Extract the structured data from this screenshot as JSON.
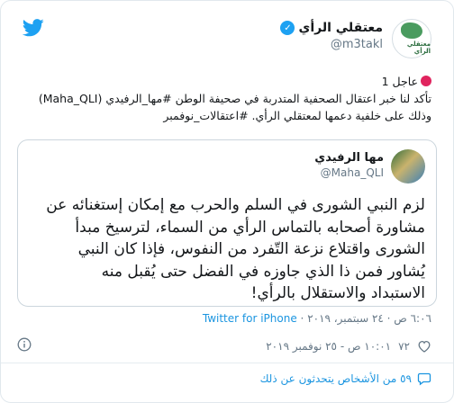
{
  "account": {
    "display_name": "معتقلي الرأي",
    "handle": "@m3takl",
    "avatar_text": "معتقلي الرأي"
  },
  "tweet": {
    "lines": [
      "عاجل 1",
      "تأكد لنا خبر اعتقال الصحفية المتدربة في صحيفة الوطن #مها_الرفيدي (Maha_QLI)",
      "وذلك على خلفية دعمها لمعتقلي الرأي. #اعتقالات_نوفمبر"
    ]
  },
  "quote": {
    "display_name": "مها الرفيدي",
    "handle": "@Maha_QLI",
    "lines": [
      "لزم النبي الشورى في السلم والحرب مع إمكان إستغنائه عن",
      "مشاورة أصحابه بالتماس الرأي من السماء، لترسيخ مبدأ",
      "الشورى واقتلاع نزعة التّفرد من النفوس، فإذا كان النبي",
      "يُشاور فمن ذا الذي جاوزه في الفضل حتى يُقبل منه",
      "الاستبداد والاستقلال بالرأي!"
    ],
    "meta_time": "٦:٠٦ ص · ٢٤ سبتمبر، ٢٠١٩ ·",
    "meta_source": "Twitter for iPhone"
  },
  "stats": {
    "likes": "٧٢",
    "timestamp": "١٠:٠١ ص - ٢٥ نوفمبر ٢٠١٩"
  },
  "footer": {
    "text": "٥٩ من الأشخاص يتحدثون عن ذلك"
  },
  "colors": {
    "link": "#1b95e0",
    "verified": "#1da1f2",
    "urgent_dot": "#e0245e",
    "muted": "#657786"
  },
  "icons": [
    "twitter-bird-icon",
    "verified-badge-icon",
    "info-icon",
    "heart-icon",
    "chat-bubble-icon"
  ]
}
